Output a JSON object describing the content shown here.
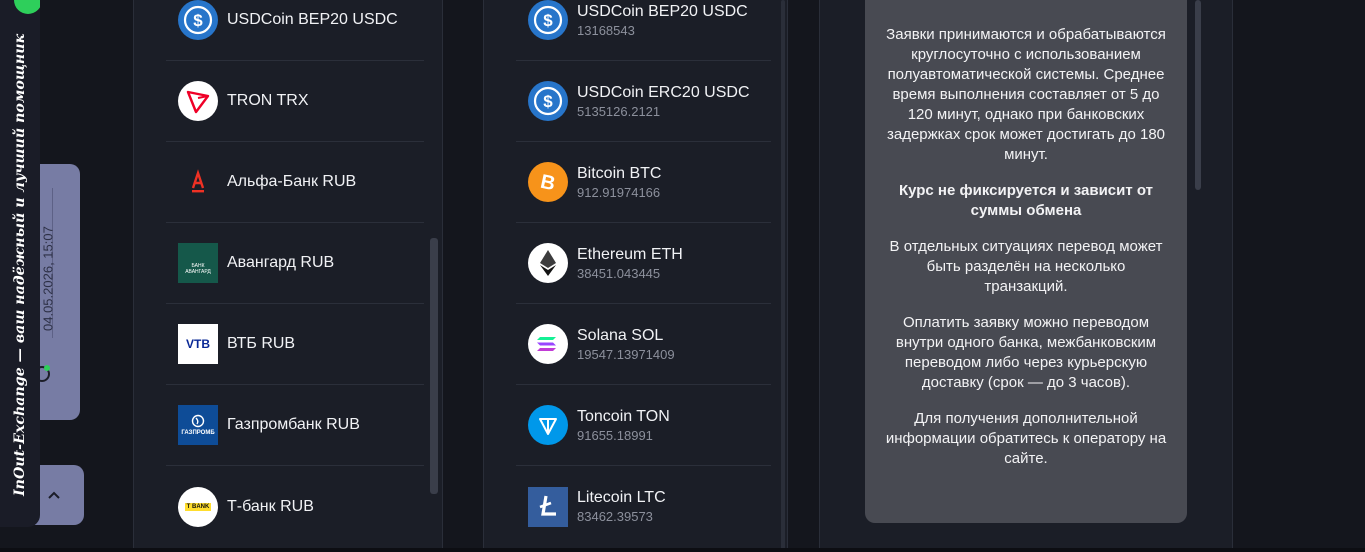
{
  "give_list": [
    {
      "name": "USDCoin BEP20 USDC",
      "icon": "usdc-icon"
    },
    {
      "name": "TRON TRX",
      "icon": "tron-icon"
    },
    {
      "name": "Альфа-Банк RUB",
      "icon": "alfa-bank-icon"
    },
    {
      "name": "Авангард RUB",
      "icon": "avangard-icon"
    },
    {
      "name": "ВТБ RUB",
      "icon": "vtb-icon"
    },
    {
      "name": "Газпромбанк RUB",
      "icon": "gazprombank-icon"
    },
    {
      "name": "Т-банк RUB",
      "icon": "tbank-icon"
    }
  ],
  "get_list": [
    {
      "name": "USDCoin BEP20 USDC",
      "reserve": "13168543",
      "icon": "usdc-icon"
    },
    {
      "name": "USDCoin ERC20 USDC",
      "reserve": "5135126.2121",
      "icon": "usdc-icon"
    },
    {
      "name": "Bitcoin BTC",
      "reserve": "912.91974166",
      "icon": "bitcoin-icon"
    },
    {
      "name": "Ethereum ETH",
      "reserve": "38451.043445",
      "icon": "ethereum-icon"
    },
    {
      "name": "Solana SOL",
      "reserve": "19547.13971409",
      "icon": "solana-icon"
    },
    {
      "name": "Toncoin TON",
      "reserve": "91655.18991",
      "icon": "toncoin-icon"
    },
    {
      "name": "Litecoin LTC",
      "reserve": "83462.39573",
      "icon": "litecoin-icon"
    }
  ],
  "info": {
    "p1": "Заявки принимаются и обрабатываются круглосуточно с использованием полуавтоматической системы. Среднее время выполнения составляет от 5 до 120 минут, однако при банковских задержках срок может достигать до 180 минут.",
    "p2": "Курс не фиксируется и зависит от суммы обмена",
    "p3": "В отдельных ситуациях перевод может быть разделён на несколько транзакций.",
    "p4": "Оплатить заявку можно переводом внутри одного банка, межбанковским переводом либо через курьерскую доставку (срок — до 3 часов).",
    "p5": "Для получения дополнительной информации обратитесь к оператору на сайте."
  },
  "sidebar": {
    "banner": "InOut-Exchange — ваш надёжный и лучший помощник",
    "datetime": "04.05.2026, 15:07"
  },
  "icon_texts": {
    "vtb": "VTB",
    "avangard": "БАНК АВАНГАРД",
    "gazprom": "ГАЗПРОМБ",
    "tbank": "T BANK"
  },
  "colors": {
    "usdc": "#2775ca",
    "bitcoin": "#f7931a",
    "toncoin": "#0098ea",
    "litecoin": "#345d9d",
    "tron": "#ef0027",
    "alfa": "#ef3124",
    "accent_green": "#2ecf5b"
  }
}
